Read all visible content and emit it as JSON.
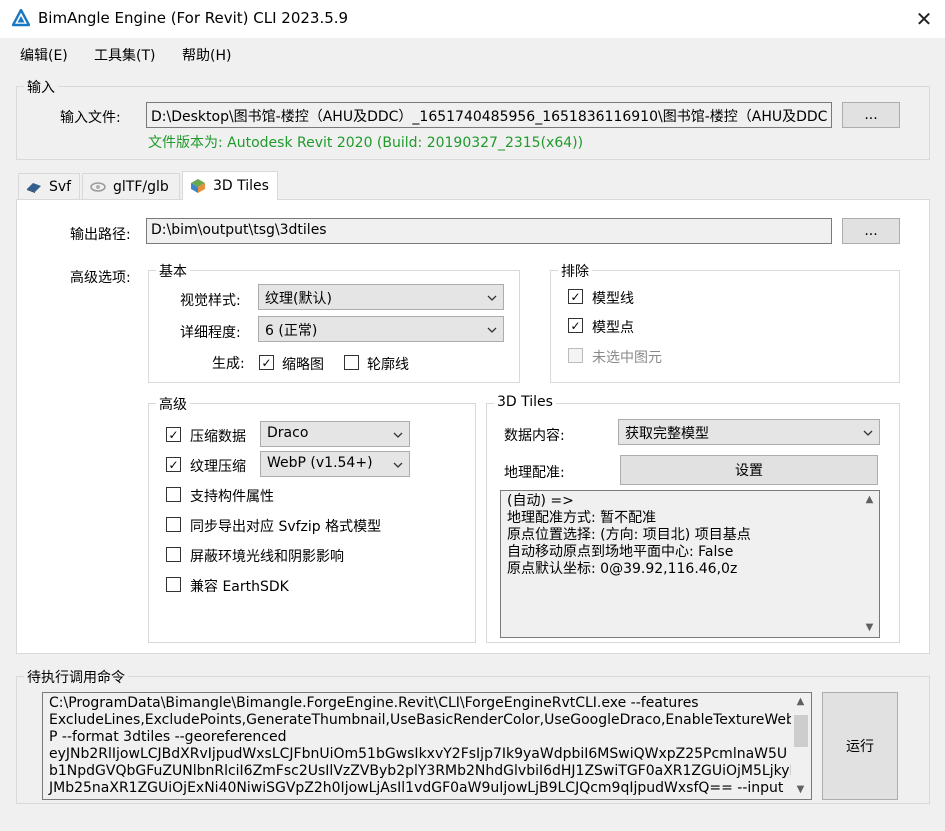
{
  "window": {
    "title": "BimAngle Engine (For Revit) CLI 2023.5.9"
  },
  "menu": [
    "编辑(E)",
    "工具集(T)",
    "帮助(H)"
  ],
  "input_group": {
    "title": "输入",
    "file_label": "输入文件:",
    "file_value": "D:\\Desktop\\图书馆-楼控（AHU及DDC）_1651740485956_1651836116910\\图书馆-楼控（AHU及DDC",
    "browse_label": "...",
    "version_text": "文件版本为: Autodesk Revit 2020 (Build: 20190327_2315(x64))"
  },
  "tabs": [
    {
      "label": "Svf",
      "icon": "svf-icon"
    },
    {
      "label": "glTF/glb",
      "icon": "gltf-icon"
    },
    {
      "label": "3D Tiles",
      "icon": "3dtiles-icon"
    }
  ],
  "output": {
    "label": "输出路径:",
    "value": "D:\\bim\\output\\tsg\\3dtiles",
    "browse_label": "..."
  },
  "advanced_options_label": "高级选项:",
  "basic": {
    "title": "基本",
    "visual_style_label": "视觉样式:",
    "visual_style_value": "纹理(默认)",
    "detail_level_label": "详细程度:",
    "detail_level_value": "6 (正常)",
    "generate_label": "生成:",
    "thumbnail": {
      "label": "缩略图",
      "checked": true
    },
    "outline": {
      "label": "轮廓线",
      "checked": false
    }
  },
  "exclude": {
    "title": "排除",
    "items": [
      {
        "label": "模型线",
        "checked": true,
        "enabled": true
      },
      {
        "label": "模型点",
        "checked": true,
        "enabled": true
      },
      {
        "label": "未选中图元",
        "checked": false,
        "enabled": false
      }
    ]
  },
  "advanced": {
    "title": "高级",
    "compress_data": {
      "label": "压缩数据",
      "checked": true,
      "value": "Draco"
    },
    "texture_compress": {
      "label": "纹理压缩",
      "checked": true,
      "value": "WebP (v1.54+)"
    },
    "items": [
      {
        "label": "支持构件属性",
        "checked": false
      },
      {
        "label": "同步导出对应 Svfzip 格式模型",
        "checked": false
      },
      {
        "label": "屏蔽环境光线和阴影影响",
        "checked": false
      },
      {
        "label": "兼容 EarthSDK",
        "checked": false
      }
    ]
  },
  "tiles": {
    "title": "3D Tiles",
    "data_content_label": "数据内容:",
    "data_content_value": "获取完整模型",
    "georef_label": "地理配准:",
    "georef_button": "设置",
    "info_lines": [
      "(自动) =>",
      "地理配准方式: 暂不配准",
      "原点位置选择: (方向: 项目北) 项目基点",
      "自动移动原点到场地平面中心: False",
      "原点默认坐标: 0@39.92,116.46,0z"
    ]
  },
  "command": {
    "title": "待执行调用命令",
    "lines": [
      "C:\\ProgramData\\Bimangle\\Bimangle.ForgeEngine.Revit\\CLI\\ForgeEngineRvtCLI.exe --features",
      "ExcludeLines,ExcludePoints,GenerateThumbnail,UseBasicRenderColor,UseGoogleDraco,EnableTextureWeb",
      "P --format 3dtiles --georeferenced",
      "eyJNb2RlIjowLCJBdXRvIjpudWxsLCJFbnUiOm51bGwsIkxvY2FsIjp7Ik9yaWdpbiI6MSwiQWxpZ25PcmlnaW5U",
      "b1NpdGVQbGFuZUNlbnRlciI6ZmFsc2UsIlVzZVByb2plY3RMb2NhdGlvbiI6dHJ1ZSwiTGF0aXR1ZGUiOjM5LjkyLC",
      "JMb25naXR1ZGUiOjExNi40NiwiSGVpZ2h0IjowLjAsIl1vdGF0aW9uIjowLjB9LCJQcm9qIjpudWxsfQ== --input"
    ],
    "run_button": "运行"
  }
}
